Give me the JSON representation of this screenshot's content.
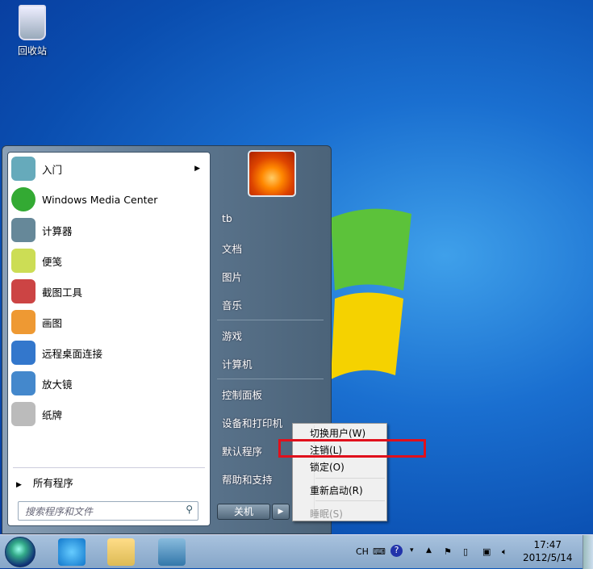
{
  "desktop": {
    "recycle_bin": "回收站"
  },
  "start_menu": {
    "programs": [
      {
        "label": "入门",
        "has_submenu": true,
        "color": "#6ab"
      },
      {
        "label": "Windows Media Center",
        "color": "#3a3"
      },
      {
        "label": "计算器",
        "color": "#689"
      },
      {
        "label": "便笺",
        "color": "#cd5"
      },
      {
        "label": "截图工具",
        "color": "#c44"
      },
      {
        "label": "画图",
        "color": "#e93"
      },
      {
        "label": "远程桌面连接",
        "color": "#37c"
      },
      {
        "label": "放大镜",
        "color": "#48c"
      },
      {
        "label": "纸牌",
        "color": "#bbb"
      }
    ],
    "all_programs": "所有程序",
    "search_placeholder": "搜索程序和文件",
    "right_items": [
      "tb",
      "文档",
      "图片",
      "音乐",
      "游戏",
      "计算机",
      "控制面板",
      "设备和打印机",
      "默认程序",
      "帮助和支持"
    ],
    "shutdown": "关机"
  },
  "context_menu": {
    "items": [
      {
        "label": "切换用户(W)"
      },
      {
        "label": "注销(L)",
        "highlighted": true
      },
      {
        "label": "锁定(O)"
      },
      {
        "label": "重新启动(R)"
      },
      {
        "label": "睡眠(S)",
        "disabled": true
      }
    ]
  },
  "taskbar": {
    "lang": "CH",
    "time": "17:47",
    "date": "2012/5/14"
  },
  "colors": {
    "highlight_box": "#e0101c"
  }
}
